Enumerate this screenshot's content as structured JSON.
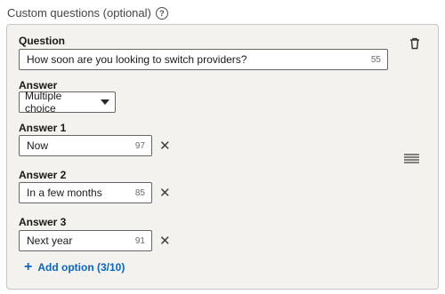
{
  "section": {
    "title": "Custom questions (optional)",
    "help_icon": "?"
  },
  "question": {
    "label": "Question",
    "value": "How soon are you looking to switch providers?",
    "remaining": "55"
  },
  "answer_type": {
    "label": "Answer",
    "selected": "Multiple choice"
  },
  "answers": [
    {
      "label": "Answer 1",
      "value": "Now",
      "remaining": "97"
    },
    {
      "label": "Answer 2",
      "value": "In a few months",
      "remaining": "85"
    },
    {
      "label": "Answer 3",
      "value": "Next year",
      "remaining": "91"
    }
  ],
  "remove_symbol": "✕",
  "add_option": {
    "plus": "+",
    "label": "Add option (3/10)"
  },
  "colors": {
    "accent": "#0a66c2",
    "card_bg": "#f3f2ef",
    "border": "#c6c6c6"
  },
  "icons": [
    "help-icon",
    "trash-icon",
    "drag-handle-icon",
    "close-icon",
    "plus-icon",
    "caret-down-icon"
  ]
}
